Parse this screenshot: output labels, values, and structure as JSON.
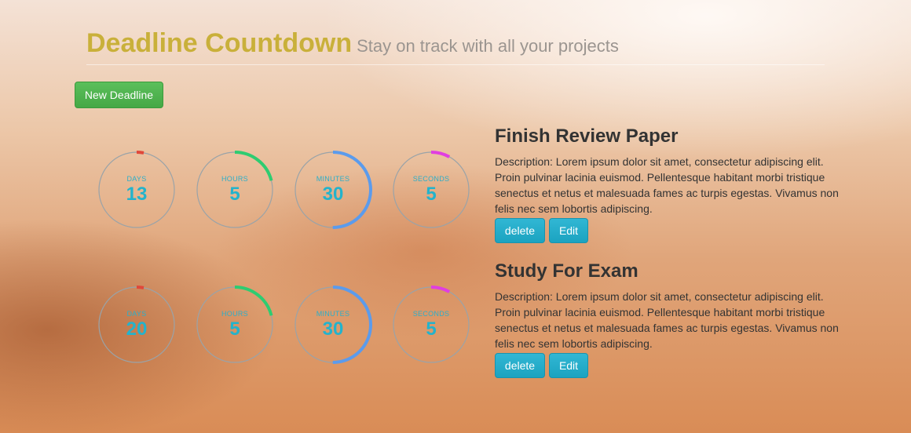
{
  "header": {
    "title": "Deadline Countdown",
    "subtitle": "Stay on track with all your projects"
  },
  "toolbar": {
    "new_label": "New Deadline"
  },
  "units": {
    "days": "DAYS",
    "hours": "HOURS",
    "minutes": "MINUTES",
    "seconds": "SECONDS"
  },
  "colors": {
    "days": "#e0483a",
    "hours": "#2ecc71",
    "minutes": "#5b9bec",
    "seconds": "#e03ee0",
    "track": "#9aa3a8"
  },
  "deadlines": [
    {
      "title": "Finish Review Paper",
      "description": "Description: Lorem ipsum dolor sit amet, consectetur adipiscing elit. Proin pulvinar lacinia euismod. Pellentesque habitant morbi tristique senectus et netus et malesuada fames ac turpis egestas. Vivamus non felis nec sem lobortis adipiscing.",
      "delete_label": "delete",
      "edit_label": "Edit",
      "countdown": {
        "days": "13",
        "hours": "5",
        "minutes": "30",
        "seconds": "5"
      },
      "progress": {
        "days": 0.03,
        "hours": 0.21,
        "minutes": 0.5,
        "seconds": 0.08
      }
    },
    {
      "title": "Study For Exam",
      "description": "Description: Lorem ipsum dolor sit amet, consectetur adipiscing elit. Proin pulvinar lacinia euismod. Pellentesque habitant morbi tristique senectus et netus et malesuada fames ac turpis egestas. Vivamus non felis nec sem lobortis adipiscing.",
      "delete_label": "delete",
      "edit_label": "Edit",
      "countdown": {
        "days": "20",
        "hours": "5",
        "minutes": "30",
        "seconds": "5"
      },
      "progress": {
        "days": 0.03,
        "hours": 0.21,
        "minutes": 0.5,
        "seconds": 0.08
      }
    }
  ]
}
